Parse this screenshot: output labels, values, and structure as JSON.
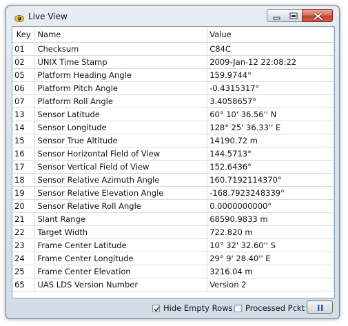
{
  "window": {
    "title": "Live View"
  },
  "table": {
    "columns": {
      "key": "Key",
      "name": "Name",
      "value": "Value"
    },
    "rows": [
      {
        "key": "01",
        "name": "Checksum",
        "value": "C84C"
      },
      {
        "key": "02",
        "name": "UNIX Time Stamp",
        "value": "2009-Jan-12 22:08:22"
      },
      {
        "key": "05",
        "name": "Platform Heading Angle",
        "value": "159.9744°"
      },
      {
        "key": "06",
        "name": "Platform Pitch Angle",
        "value": "-0.4315317°"
      },
      {
        "key": "07",
        "name": "Platform Roll Angle",
        "value": "3.4058657°"
      },
      {
        "key": "13",
        "name": "Sensor Latitude",
        "value": "60° 10' 36.56'' N"
      },
      {
        "key": "14",
        "name": "Sensor Longitude",
        "value": "128° 25' 36.33'' E"
      },
      {
        "key": "15",
        "name": "Sensor True Altitude",
        "value": "14190.72 m"
      },
      {
        "key": "16",
        "name": "Sensor Horizontal Field of View",
        "value": "144.5713°"
      },
      {
        "key": "17",
        "name": "Sensor Vertical Field of View",
        "value": "152.6436°"
      },
      {
        "key": "18",
        "name": "Sensor Relative Azimuth Angle",
        "value": "160.7192114370°"
      },
      {
        "key": "19",
        "name": "Sensor Relative Elevation Angle",
        "value": "-168.7923248339°"
      },
      {
        "key": "20",
        "name": "Sensor Relative Roll Angle",
        "value": "0.0000000000°"
      },
      {
        "key": "21",
        "name": "Slant Range",
        "value": "68590.9833 m"
      },
      {
        "key": "22",
        "name": "Target Width",
        "value": "722.820 m"
      },
      {
        "key": "23",
        "name": "Frame Center Latitude",
        "value": "10° 32' 32.60'' S"
      },
      {
        "key": "24",
        "name": "Frame Center Longitude",
        "value": "29°  9' 28.40'' E"
      },
      {
        "key": "25",
        "name": "Frame Center Elevation",
        "value": "3216.04 m"
      },
      {
        "key": "65",
        "name": "UAS LDS Version Number",
        "value": "Version 2"
      }
    ]
  },
  "footer": {
    "hide_empty_rows": {
      "label": "Hide Empty Rows",
      "checked": true
    },
    "processed_pckt": {
      "label": "Processed Pckt",
      "checked": false
    },
    "pause_icon": "pause-icon"
  },
  "colors": {
    "close_button": "#c24631",
    "window_frame": "#d9e3ee"
  }
}
